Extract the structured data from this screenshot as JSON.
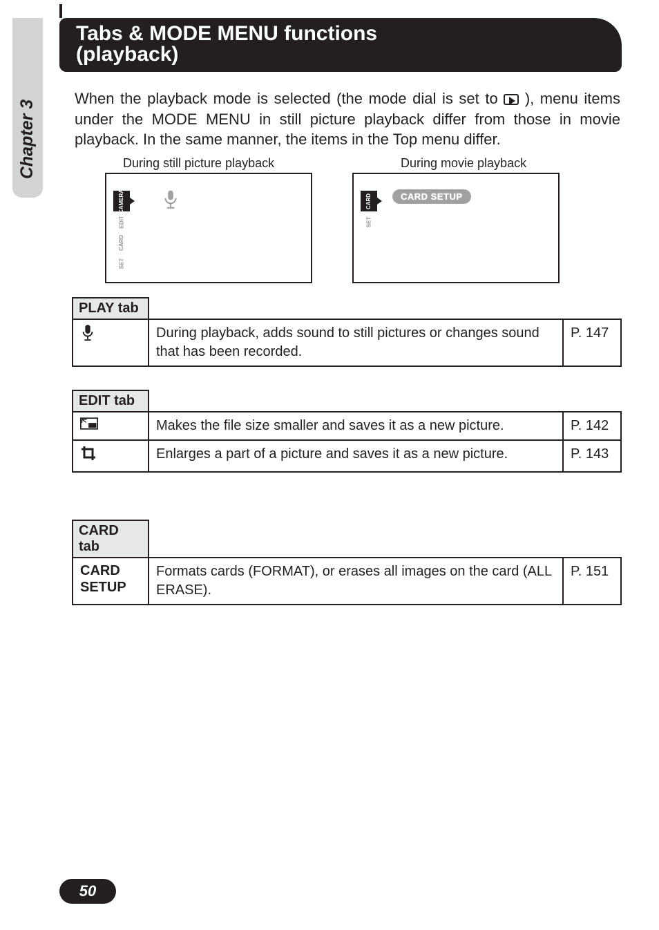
{
  "chapter_label": "Chapter 3",
  "title_line1": "Tabs & MODE MENU functions",
  "title_line2": "(playback)",
  "intro_before_icon": "When the playback mode is selected (the mode dial is set to ",
  "intro_after_icon": "), menu items under the MODE MENU in still picture playback differ from those in movie playback. In the same manner, the items in the Top menu differ.",
  "caption_left": "During still picture playback",
  "caption_right": "During movie playback",
  "screen_left": {
    "tabs": [
      "SET",
      "CARD",
      "EDIT",
      "CAMERA"
    ],
    "active_index": 3
  },
  "screen_right": {
    "tabs": [
      "SET",
      "CARD"
    ],
    "active_index": 1,
    "pill": "CARD SETUP"
  },
  "tables": {
    "play": {
      "head": "PLAY tab",
      "rows": [
        {
          "icon": "microphone",
          "desc": "During playback, adds sound to still pictures or changes sound that has been recorded.",
          "page": "P. 147"
        }
      ]
    },
    "edit": {
      "head": "EDIT tab",
      "rows": [
        {
          "icon": "resize",
          "desc": "Makes the file size smaller and saves it as a new picture.",
          "page": "P. 142"
        },
        {
          "icon": "crop",
          "desc": "Enlarges a part of a picture and saves it as a new picture.",
          "page": "P. 143"
        }
      ]
    },
    "card": {
      "head": "CARD tab",
      "rows": [
        {
          "label": "CARD SETUP",
          "desc": "Formats cards (FORMAT), or erases all images on the card (ALL ERASE).",
          "page": "P. 151"
        }
      ]
    }
  },
  "page_number": "50"
}
